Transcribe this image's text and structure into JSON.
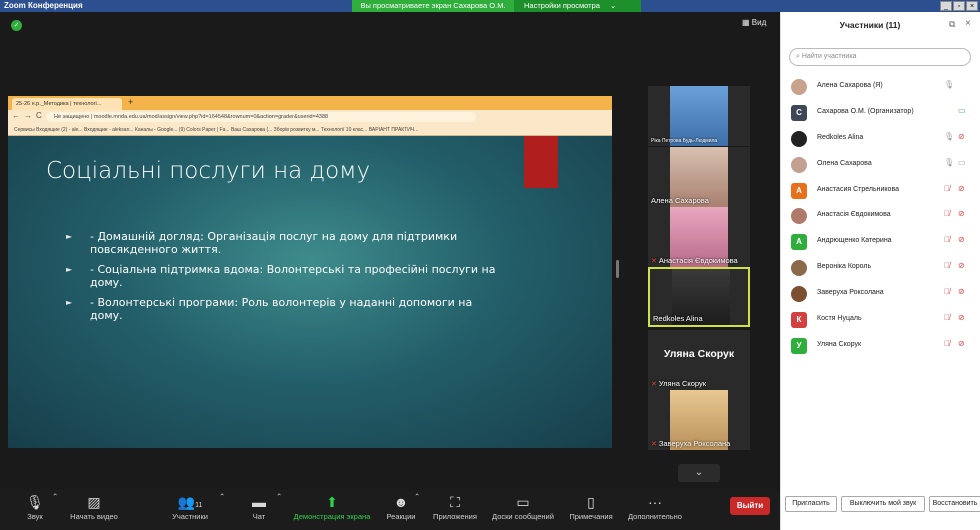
{
  "window": {
    "title": "Zoom Конференция",
    "share_banner": "Вы просматриваете экран Сахарова О.М.",
    "view_settings": "Настройки просмотра",
    "view_settings_chevron": "⌄"
  },
  "main": {
    "view_label": "Вид"
  },
  "browser": {
    "tab_title": "25-26 н.р._Методика | технологі...",
    "address": "Не защищено | moodle.mnda.edu.ua/mod/assign/view.php?id=164548&rownum=0&action=grader&userid=4388",
    "bookmarks": "Сервисы  Входящие (2) - ale...  Входящие - aleksan...  Каналы - Google...  (9) Colors Paper | Fa...  Ваш Сахарова (...  Зборів розвитку м...  Технології 10 клас...  ВАРІАНТ ПРАКТИЧ..."
  },
  "slide": {
    "title": "Соціальні послуги на дому",
    "bullets": [
      "- Домашній догляд: Організація послуг на дому для підтримки повсякденного життя.",
      "- Соціальна підтримка вдома: Волонтерські та професійні послуги на дому.",
      "- Волонтерські програми: Роль волонтерів у наданні допомоги на дому."
    ]
  },
  "tiles": [
    {
      "name": "Ріка Петрова Будь-Людмила",
      "muted": false
    },
    {
      "name": "Алена Сахарова",
      "muted": false
    },
    {
      "name": "Анастасія Євдокимова",
      "muted": true
    },
    {
      "name": "Redkoles Alina",
      "muted": false
    },
    {
      "big": "Уляна Скорук",
      "name": "Уляна Скорук",
      "muted": true
    },
    {
      "name": "Заверуха Роксолана",
      "muted": true
    }
  ],
  "toolbar": {
    "audio": "Звук",
    "video": "Начать видео",
    "participants": "Участники",
    "participants_count": "11",
    "chat": "Чат",
    "share": "Демонстрация экрана",
    "reactions": "Реакции",
    "apps": "Приложения",
    "whiteboards": "Доски сообщений",
    "notes": "Примечания",
    "more": "Дополнительно",
    "leave": "Выйти"
  },
  "panel": {
    "title": "Участники (11)",
    "search_placeholder": "Найти участника",
    "participants": [
      {
        "name": "Алена Сахарова (Я)",
        "avatar": "photo",
        "color": "#c9a28e",
        "mic": "on",
        "cam": "none"
      },
      {
        "name": "Сахарова О.М. (Организатор)",
        "avatar": "С",
        "color": "#3e4757",
        "mic": "none",
        "cam": "green"
      },
      {
        "name": "Redkoles Alina",
        "avatar": "photo",
        "color": "#222222",
        "mic": "on",
        "cam": "off"
      },
      {
        "name": "Олена Сахарова",
        "avatar": "photo",
        "color": "#c4a090",
        "mic": "on",
        "cam": "on"
      },
      {
        "name": "Анастасия Стрельникова",
        "avatar": "А",
        "color": "#e8701a",
        "mic": "off",
        "cam": "off"
      },
      {
        "name": "Анастасія Євдокимова",
        "avatar": "photo",
        "color": "#b07a6a",
        "mic": "off",
        "cam": "off"
      },
      {
        "name": "Андрющенко Катерина",
        "avatar": "А",
        "color": "#2fae3c",
        "mic": "off",
        "cam": "off"
      },
      {
        "name": "Вероніка Король",
        "avatar": "photo",
        "color": "#8a6a4a",
        "mic": "off",
        "cam": "off"
      },
      {
        "name": "Заверуха Роксолана",
        "avatar": "photo",
        "color": "#7a5030",
        "mic": "off",
        "cam": "off"
      },
      {
        "name": "Костя Нуцаль",
        "avatar": "К",
        "color": "#d24040",
        "mic": "off",
        "cam": "off"
      },
      {
        "name": "Уляна Скорук",
        "avatar": "У",
        "color": "#2fae3c",
        "mic": "off",
        "cam": "off"
      }
    ],
    "btn_invite": "Пригласить",
    "btn_mute_me": "Выключить мой звук",
    "btn_restore": "Восстановить"
  },
  "colors": {
    "accent_green": "#2fae3c",
    "leave_red": "#c92929",
    "muted_red": "#e04848",
    "zoom_blue": "#2b4f8f"
  }
}
